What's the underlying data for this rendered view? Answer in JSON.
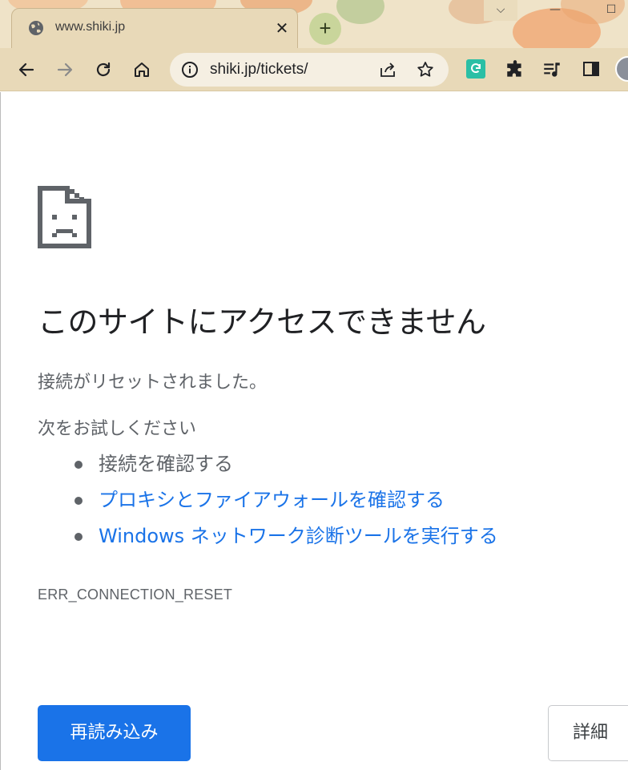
{
  "browser": {
    "tab": {
      "title": "www.shiki.jp",
      "close_glyph": "✕",
      "favicon": "globe-icon"
    },
    "new_tab_glyph": "+",
    "window_controls": {
      "dropdown": "⌵",
      "minimize": "—",
      "maximize": "☐"
    },
    "omnibox": {
      "url": "shiki.jp/tickets/"
    },
    "colors": {
      "frame": "#e8d9b8",
      "omnibox": "#f5efe2",
      "accent": "#1a73e8"
    }
  },
  "error_page": {
    "headline": "このサイトにアクセスできません",
    "subtitle": "接続がリセットされました。",
    "try_label": "次をお試しください",
    "suggestions": [
      {
        "text": "接続を確認する",
        "is_link": false
      },
      {
        "text": "プロキシとファイアウォールを確認する",
        "is_link": true
      },
      {
        "text": "Windows ネットワーク診断ツールを実行する",
        "is_link": true
      }
    ],
    "error_code": "ERR_CONNECTION_RESET",
    "reload_button": "再読み込み",
    "details_button": "詳細"
  }
}
